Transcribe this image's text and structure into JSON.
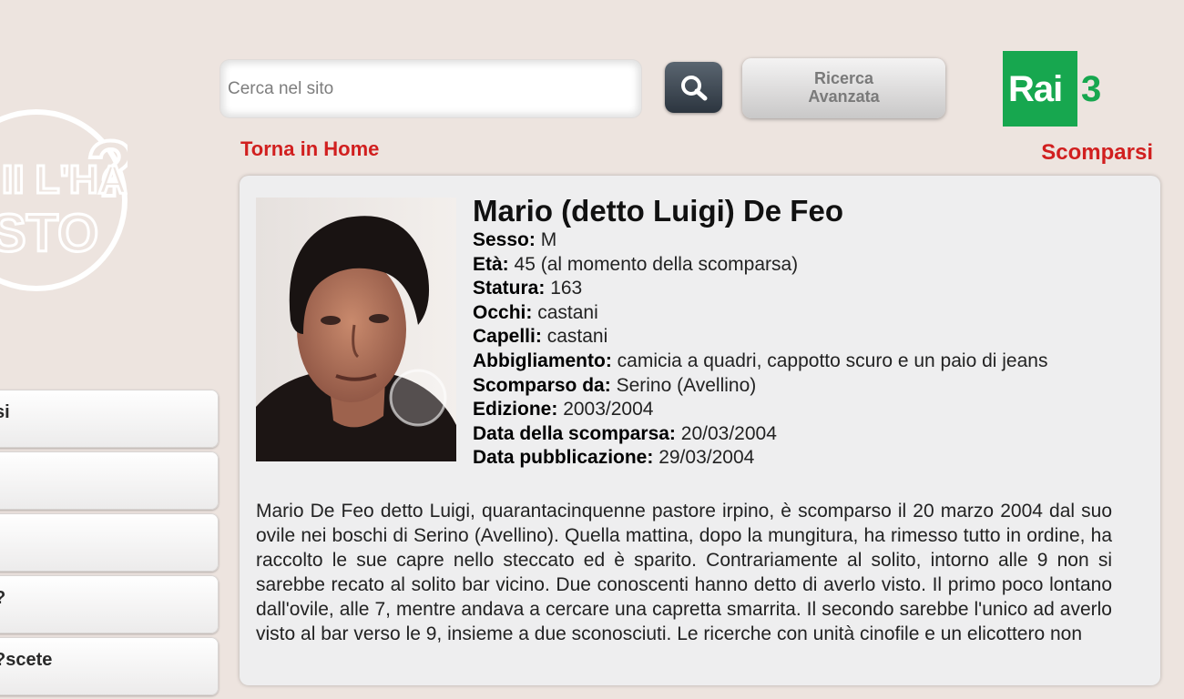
{
  "search": {
    "placeholder": "Cerca nel sito"
  },
  "advanced_search": {
    "line1": "Ricerca",
    "line2": "Avanzata"
  },
  "brand": {
    "rai": "Rai",
    "channel": "3",
    "color": "#17a74f"
  },
  "site_logo": {
    "text_line1": "II L'HA",
    "text_line2": "STO",
    "question_mark": "?"
  },
  "nav": {
    "home_link": "Torna in Home",
    "section_title": "Scomparsi"
  },
  "sidebar": {
    "items": [
      {
        "label": "si"
      },
      {
        "label": ""
      },
      {
        "label": ""
      },
      {
        "label": "?"
      },
      {
        "label": "scete?"
      }
    ]
  },
  "person": {
    "name": "Mario (detto Luigi) De Feo",
    "fields": [
      {
        "label": "Sesso:",
        "value": "M"
      },
      {
        "label": "Età:",
        "value": "45 (al momento della scomparsa)"
      },
      {
        "label": "Statura:",
        "value": "163"
      },
      {
        "label": "Occhi:",
        "value": "castani"
      },
      {
        "label": "Capelli:",
        "value": "castani"
      },
      {
        "label": "Abbigliamento:",
        "value": "camicia a quadri, cappotto scuro e un paio di jeans"
      },
      {
        "label": "Scomparso da:",
        "value": "Serino (Avellino)"
      },
      {
        "label": "Edizione:",
        "value": "2003/2004"
      },
      {
        "label": "Data della scomparsa:",
        "value": "20/03/2004"
      },
      {
        "label": "Data pubblicazione:",
        "value": "29/03/2004"
      }
    ],
    "description": "Mario De Feo detto Luigi, quarantacinquenne pastore irpino, è scomparso il 20 marzo 2004 dal suo ovile nei boschi di Serino (Avellino). Quella mattina, dopo la mungitura, ha rimesso tutto in ordine, ha raccolto le sue capre nello steccato ed è sparito. Contrariamente al solito, intorno alle 9 non si sarebbe recato al solito bar vicino. Due conoscenti hanno detto di averlo visto. Il primo poco lontano dall'ovile, alle 7, mentre andava a cercare una capretta smarrita. Il secondo sarebbe l'unico ad averlo visto al bar verso le 9, insieme a due sconosciuti. Le ricerche con unità cinofile e un elicottero non"
  }
}
